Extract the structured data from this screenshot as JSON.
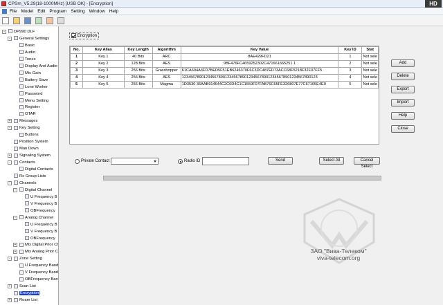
{
  "window": {
    "title": "CPSm_V5.29(18-1000MHz) [USB OK] - [Encryption]",
    "badge": "HD"
  },
  "menu": [
    "File",
    "Model",
    "Edit",
    "Program",
    "Setting",
    "Window",
    "Help"
  ],
  "tree": {
    "items": [
      {
        "label": "DP990 DLF",
        "indent": 0,
        "exp": "-"
      },
      {
        "label": "General Settings",
        "indent": 1,
        "exp": "-"
      },
      {
        "label": "Basic",
        "indent": 2
      },
      {
        "label": "Audio",
        "indent": 2
      },
      {
        "label": "Tones",
        "indent": 2
      },
      {
        "label": "Display And Audio",
        "indent": 2
      },
      {
        "label": "Mic Gain",
        "indent": 2
      },
      {
        "label": "Battery Save",
        "indent": 2
      },
      {
        "label": "Lone Worker",
        "indent": 2
      },
      {
        "label": "Password",
        "indent": 2
      },
      {
        "label": "Menu Setting",
        "indent": 2
      },
      {
        "label": "Register",
        "indent": 2
      },
      {
        "label": "OTAR",
        "indent": 2
      },
      {
        "label": "Messages",
        "indent": 1,
        "exp": "+"
      },
      {
        "label": "Key Setting",
        "indent": 1,
        "exp": "-"
      },
      {
        "label": "Buttons",
        "indent": 2
      },
      {
        "label": "Position System",
        "indent": 1
      },
      {
        "label": "Man Down",
        "indent": 1
      },
      {
        "label": "Signaling System",
        "indent": 1,
        "exp": "+"
      },
      {
        "label": "Contacts",
        "indent": 1,
        "exp": "-"
      },
      {
        "label": "Digital Contacts",
        "indent": 2
      },
      {
        "label": "Rx Group Lists",
        "indent": 1
      },
      {
        "label": "Channels",
        "indent": 1,
        "exp": "-"
      },
      {
        "label": "Digital Channel",
        "indent": 2,
        "exp": "-"
      },
      {
        "label": "U Frequency B",
        "indent": 3
      },
      {
        "label": "V Frequency B",
        "indent": 3
      },
      {
        "label": "OBFrequency",
        "indent": 3
      },
      {
        "label": "Analog Channel",
        "indent": 2,
        "exp": "-"
      },
      {
        "label": "U Frequency B",
        "indent": 3
      },
      {
        "label": "V Frequency B",
        "indent": 3
      },
      {
        "label": "OBFrequency",
        "indent": 3
      },
      {
        "label": "Mix Digital Prior Ch",
        "indent": 2,
        "exp": "+"
      },
      {
        "label": "Mix Analog Prior Ch",
        "indent": 2,
        "exp": "+"
      },
      {
        "label": "Zone Setting",
        "indent": 1,
        "exp": "-"
      },
      {
        "label": "U Frequency Band",
        "indent": 2
      },
      {
        "label": "V Frequency Band",
        "indent": 2
      },
      {
        "label": "OBFrequency Ban",
        "indent": 2
      },
      {
        "label": "Scan List",
        "indent": 1,
        "exp": "+"
      },
      {
        "label": "Encryption",
        "indent": 1,
        "selected": true
      },
      {
        "label": "Roam List",
        "indent": 1,
        "exp": "+"
      }
    ]
  },
  "encryption": {
    "enable_label": "Encryption",
    "columns": [
      "No.",
      "Key Alias",
      "Key Length",
      "Algorithm",
      "Key Value",
      "Key ID",
      "Stat"
    ],
    "rows": [
      [
        "1",
        "Key 1",
        "40 Bits",
        "ARC",
        "8AE429FD21",
        "1",
        "Not sele"
      ],
      [
        "2",
        "Key 2",
        "128 Bits",
        "AES",
        "9BF476FC4659252302C471661665251 1",
        "2",
        "Not sele"
      ],
      [
        "3",
        "Key 3",
        "256 Bits",
        "Grasshopper",
        "61CA694A3FD7BED5F51EB6246370F6C3DC487ED73ACC68F5218F32F07FF5",
        "3",
        "Not sele"
      ],
      [
        "4",
        "Key 4",
        "256 Bits",
        "AES",
        "123456789012345678901234567890123456789012345678901234567890123",
        "4",
        "Not sele"
      ],
      [
        "5",
        "Key 5",
        "256 Bits",
        "Magma",
        "1D3530 36AAB914644C2C6D4C1C1559F07FAB76C65FE326807E77C67105E4E0",
        "5",
        "Not sele"
      ]
    ],
    "buttons": [
      "Add",
      "Delete",
      "Export",
      "Import",
      "Help",
      "Close"
    ],
    "private_contact_label": "Private Contact",
    "private_contact_value": "",
    "radio_id_label": "Radio ID",
    "radio_id_value": "",
    "send_label": "Send",
    "select_all_label": "Select All",
    "cancel_select_label": "Cancel Select",
    "progress": 0
  },
  "watermark": {
    "line1": "ЗАО \"Вива-Телеком\"",
    "line2": "viva-telecom.org"
  }
}
